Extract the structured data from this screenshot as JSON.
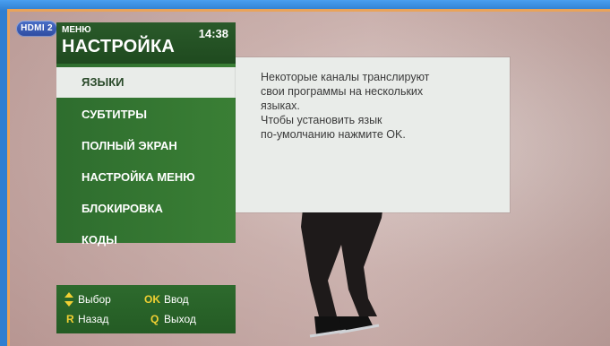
{
  "source_badge": "HDMI 2",
  "menu": {
    "caption": "МЕНЮ",
    "title": "НАСТРОЙКА",
    "clock": "14:38",
    "items": [
      {
        "label": "ЯЗЫКИ",
        "selected": true
      },
      {
        "label": "СУБТИТРЫ",
        "selected": false
      },
      {
        "label": "ПОЛНЫЙ ЭКРАН",
        "selected": false
      },
      {
        "label": "НАСТРОЙКА МЕНЮ",
        "selected": false
      },
      {
        "label": "БЛОКИРОВКА",
        "selected": false
      },
      {
        "label": "КОДЫ",
        "selected": false
      }
    ]
  },
  "info": {
    "lines": [
      "Некоторые каналы транслируют",
      "свои программы на нескольких",
      "языках.",
      "Чтобы установить язык",
      "по-умолчанию нажмите OK."
    ]
  },
  "legend": {
    "select_icon": "up-down-arrows-icon",
    "select_label": "Выбор",
    "ok_key": "OK",
    "ok_label": "Ввод",
    "back_key": "R",
    "back_label": "Назад",
    "exit_key": "Q",
    "exit_label": "Выход"
  },
  "colors": {
    "menu_green": "#2e6d2e",
    "selected_bg": "#e9ece9",
    "key_yellow": "#f1d033",
    "badge_blue": "#3b5fb5"
  }
}
